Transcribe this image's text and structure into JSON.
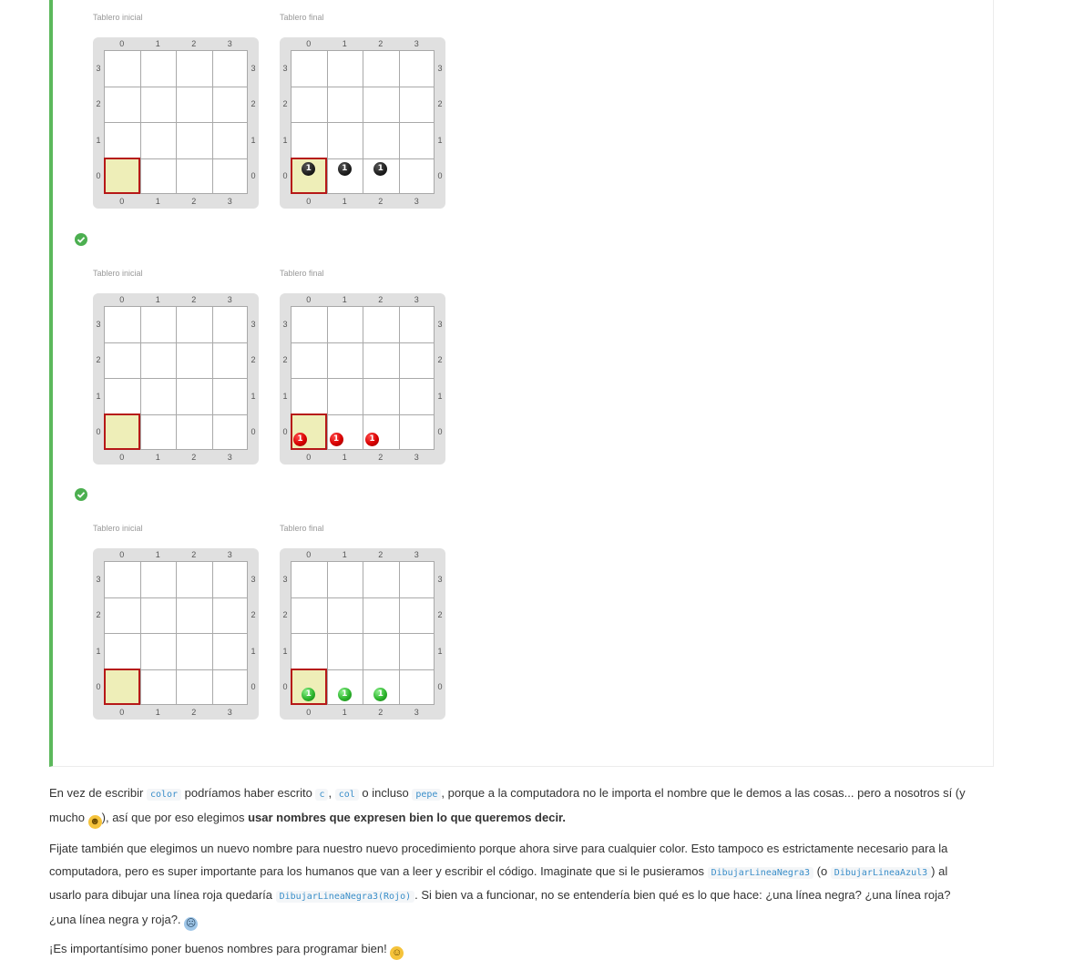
{
  "boards": [
    {
      "initial_label": "Tablero inicial",
      "final_label": "Tablero final",
      "col_labels": [
        "0",
        "1",
        "2",
        "3"
      ],
      "row_labels": [
        "3",
        "2",
        "1",
        "0"
      ],
      "final_balls": [
        {
          "col": 0,
          "color": "black",
          "count": "1"
        },
        {
          "col": 1,
          "color": "black",
          "count": "1"
        },
        {
          "col": 2,
          "color": "black",
          "count": "1"
        }
      ]
    },
    {
      "initial_label": "Tablero inicial",
      "final_label": "Tablero final",
      "col_labels": [
        "0",
        "1",
        "2",
        "3"
      ],
      "row_labels": [
        "3",
        "2",
        "1",
        "0"
      ],
      "final_balls": [
        {
          "col": 0,
          "color": "red",
          "count": "1"
        },
        {
          "col": 1,
          "color": "red",
          "count": "1"
        },
        {
          "col": 2,
          "color": "red",
          "count": "1"
        }
      ]
    },
    {
      "initial_label": "Tablero inicial",
      "final_label": "Tablero final",
      "col_labels": [
        "0",
        "1",
        "2",
        "3"
      ],
      "row_labels": [
        "3",
        "2",
        "1",
        "0"
      ],
      "final_balls": [
        {
          "col": 0,
          "color": "green",
          "count": "1"
        },
        {
          "col": 1,
          "color": "green",
          "count": "1"
        },
        {
          "col": 2,
          "color": "green",
          "count": "1"
        }
      ]
    }
  ],
  "colors": {
    "accent_green": "#5cb85c",
    "check_green": "#4caf50",
    "highlight_fill": "#eeeeb8",
    "highlight_border": "#b61818"
  },
  "text": {
    "p1_a": "En vez de escribir ",
    "p1_code1": "color",
    "p1_b": " podríamos haber escrito ",
    "p1_code2": "c",
    "p1_c": ", ",
    "p1_code3": "col",
    "p1_d": " o incluso ",
    "p1_code4": "pepe",
    "p1_e": ", porque a la computadora no le importa el nombre que le demos a las cosas... pero a nosotros sí (y mucho ",
    "p1_f": "), así que por eso elegimos ",
    "p1_bold": "usar nombres que expresen bien lo que queremos decir",
    "p1_g": ".",
    "p2_a": "Fijate también que elegimos un nuevo nombre para nuestro nuevo procedimiento porque ahora sirve para cualquier color. Esto tampoco es estrictamente necesario para la computadora, pero es super importante para los humanos que van a leer y escribir el código. Imaginate que si le pusieramos ",
    "p2_code1": "DibujarLineaNegra3",
    "p2_b": " (o ",
    "p2_code2": "DibujarLineaAzul3",
    "p2_c": ") al usarlo para dibujar una línea roja quedaría ",
    "p2_code3": "DibujarLineaNegra3(Rojo)",
    "p2_d": ". Si bien va a funcionar, no se entendería bien qué es lo que hace: ¿una línea negra? ¿una línea roja? ¿una línea negra y roja?. ",
    "p3_a": "¡Es importantísimo poner buenos nombres para programar bien! "
  },
  "emojis": {
    "grin": "grinning-face",
    "fear": "fearful-face",
    "smile": "smiling-face"
  }
}
